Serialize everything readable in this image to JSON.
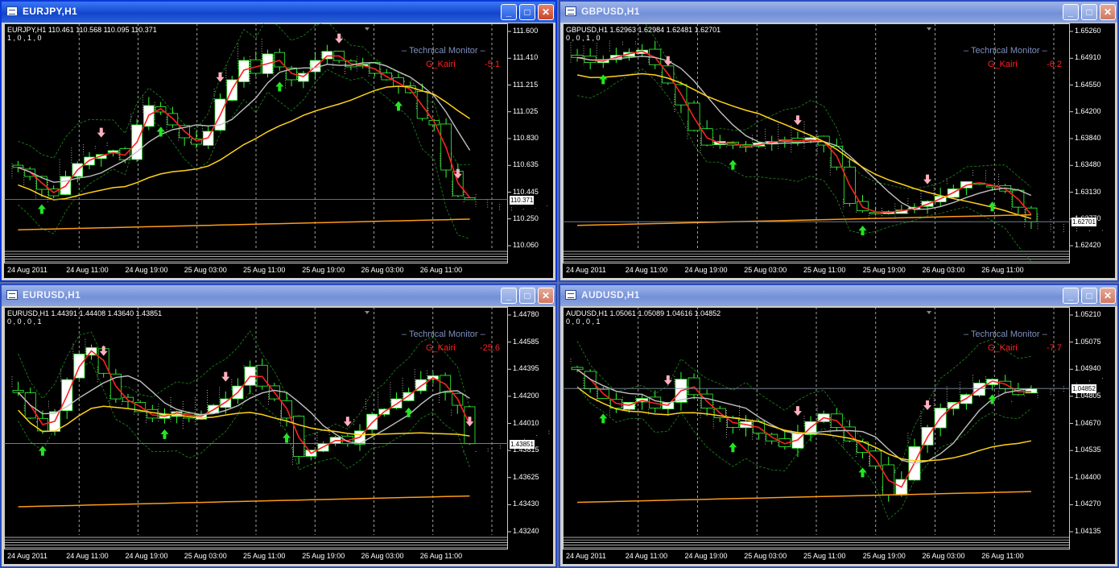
{
  "colors": {
    "bull": "#ffffff",
    "bear": "#33ff33",
    "red_ma": "#ff2020",
    "gray_ma": "#c0c0c0",
    "yellow_ma": "#ffd21a",
    "orange_ma": "#ff9a1a",
    "cloud": "#d8d8d8",
    "bands": "#1e8a1e",
    "grid": "#c8c8c8",
    "buy_arrow": "#22e622",
    "sell_arrow": "#ffb0c0"
  },
  "windows": [
    {
      "id": "eurjpy",
      "title": "EURJPY,H1",
      "active": true,
      "info": "EURJPY,H1  110.461 110.568 110.095 110.371",
      "flags": "1 , 0 , 1 , 0",
      "monitor": "Technical  Monitor",
      "kairi_label": "G_Kairi",
      "kairi_value": "-5.1",
      "current_price": "110.371",
      "prices": [
        "111.600",
        "111.410",
        "111.215",
        "111.025",
        "110.830",
        "110.635",
        "110.445",
        "110.250",
        "110.060"
      ],
      "times": [
        "24 Aug 2011",
        "24 Aug 11:00",
        "24 Aug 19:00",
        "25 Aug 03:00",
        "25 Aug 11:00",
        "25 Aug 19:00",
        "26 Aug 03:00",
        "26 Aug 11:00"
      ],
      "chart_data": {
        "type": "line",
        "symbol": "EURJPY",
        "timeframe": "H1",
        "ohlc": {
          "open": 110.461,
          "high": 110.568,
          "low": 110.095,
          "close": 110.371
        },
        "ylim": [
          110.0,
          111.7
        ],
        "close_path": [
          110.62,
          110.55,
          110.45,
          110.4,
          110.55,
          110.65,
          110.7,
          110.72,
          110.75,
          110.68,
          110.95,
          111.1,
          111.05,
          110.95,
          110.85,
          110.8,
          110.9,
          111.15,
          111.3,
          111.45,
          111.35,
          111.5,
          111.4,
          111.3,
          111.35,
          111.45,
          111.52,
          111.45,
          111.4,
          111.42,
          111.35,
          111.3,
          111.25,
          111.2,
          111.0,
          110.95,
          110.6,
          110.4,
          110.37
        ]
      }
    },
    {
      "id": "gbpusd",
      "title": "GBPUSD,H1",
      "active": false,
      "info": "GBPUSD,H1  1.62963 1.62984 1.62481 1.62701",
      "flags": "0 , 0 , 1 , 0",
      "monitor": "Technical  Monitor",
      "kairi_label": "G_Kairi",
      "kairi_value": "-6.2",
      "current_price": "1.62701",
      "prices": [
        "1.65260",
        "1.64910",
        "1.64550",
        "1.64200",
        "1.63840",
        "1.63480",
        "1.63130",
        "1.62770",
        "1.62420"
      ],
      "times": [
        "24 Aug 2011",
        "24 Aug 11:00",
        "24 Aug 19:00",
        "25 Aug 03:00",
        "25 Aug 11:00",
        "25 Aug 19:00",
        "26 Aug 03:00",
        "26 Aug 11:00"
      ],
      "chart_data": {
        "type": "line",
        "symbol": "GBPUSD",
        "timeframe": "H1",
        "ohlc": {
          "open": 1.62963,
          "high": 1.62984,
          "low": 1.62481,
          "close": 1.62701
        },
        "ylim": [
          1.6235,
          1.6535
        ],
        "close_path": [
          1.6495,
          1.6488,
          1.6492,
          1.6498,
          1.6502,
          1.6505,
          1.6485,
          1.646,
          1.643,
          1.6395,
          1.6375,
          1.638,
          1.6375,
          1.6372,
          1.6378,
          1.638,
          1.6382,
          1.6379,
          1.6385,
          1.6375,
          1.6345,
          1.6295,
          1.6285,
          1.6282,
          1.6284,
          1.6286,
          1.629,
          1.6298,
          1.6305,
          1.6315,
          1.6325,
          1.6322,
          1.6318,
          1.6312,
          1.629,
          1.627
        ]
      }
    },
    {
      "id": "eurusd",
      "title": "EURUSD,H1",
      "active": false,
      "info": "EURUSD,H1  1.44391 1.44408 1.43640 1.43851",
      "flags": "0 , 0 , 0 , 1",
      "monitor": "Technical  Monitor",
      "kairi_label": "G_Kairi",
      "kairi_value": "-25.6",
      "current_price": "1.43851",
      "prices": [
        "1.44780",
        "1.44585",
        "1.44395",
        "1.44200",
        "1.44010",
        "1.43815",
        "1.43625",
        "1.43430",
        "1.43240"
      ],
      "times": [
        "24 Aug 2011",
        "24 Aug 11:00",
        "24 Aug 19:00",
        "25 Aug 03:00",
        "25 Aug 11:00",
        "25 Aug 19:00",
        "26 Aug 03:00",
        "26 Aug 11:00"
      ],
      "chart_data": {
        "type": "line",
        "symbol": "EURUSD",
        "timeframe": "H1",
        "ohlc": {
          "open": 1.44391,
          "high": 1.44408,
          "low": 1.4364,
          "close": 1.43851
        },
        "ylim": [
          1.4315,
          1.4488
        ],
        "close_path": [
          1.4425,
          1.4405,
          1.4395,
          1.441,
          1.4435,
          1.4455,
          1.446,
          1.444,
          1.442,
          1.4418,
          1.441,
          1.4405,
          1.4408,
          1.441,
          1.4405,
          1.4408,
          1.4415,
          1.442,
          1.443,
          1.4445,
          1.443,
          1.442,
          1.4405,
          1.4375,
          1.438,
          1.4385,
          1.439,
          1.4385,
          1.4395,
          1.4408,
          1.4412,
          1.442,
          1.4425,
          1.4435,
          1.4438,
          1.4425,
          1.4415,
          1.4385
        ]
      }
    },
    {
      "id": "audusd",
      "title": "AUDUSD,H1",
      "active": false,
      "info": "AUDUSD,H1  1.05061 1.05089 1.04616 1.04852",
      "flags": "0 , 0 , 0 , 1",
      "monitor": "Technical  Monitor",
      "kairi_label": "G_Kairi",
      "kairi_value": "-7.7",
      "current_price": "1.04852",
      "prices": [
        "1.05210",
        "1.05075",
        "1.04940",
        "1.04805",
        "1.04670",
        "1.04535",
        "1.04400",
        "1.04270",
        "1.04135"
      ],
      "times": [
        "24 Aug 2011",
        "24 Aug 11:00",
        "24 Aug 19:00",
        "25 Aug 03:00",
        "25 Aug 11:00",
        "25 Aug 19:00",
        "26 Aug 03:00",
        "26 Aug 11:00"
      ],
      "chart_data": {
        "type": "line",
        "symbol": "AUDUSD",
        "timeframe": "H1",
        "ohlc": {
          "open": 1.05061,
          "high": 1.05089,
          "low": 1.04616,
          "close": 1.04852
        },
        "ylim": [
          1.041,
          1.0525
        ],
        "close_path": [
          1.0495,
          1.0485,
          1.048,
          1.0475,
          1.0478,
          1.048,
          1.0475,
          1.0478,
          1.049,
          1.0482,
          1.0475,
          1.047,
          1.0465,
          1.0468,
          1.0462,
          1.0458,
          1.0455,
          1.0462,
          1.0468,
          1.0472,
          1.0465,
          1.0458,
          1.0452,
          1.0445,
          1.043,
          1.0438,
          1.0455,
          1.0465,
          1.0475,
          1.0478,
          1.0482,
          1.0488,
          1.049,
          1.0485,
          1.0482,
          1.0485
        ]
      }
    }
  ]
}
